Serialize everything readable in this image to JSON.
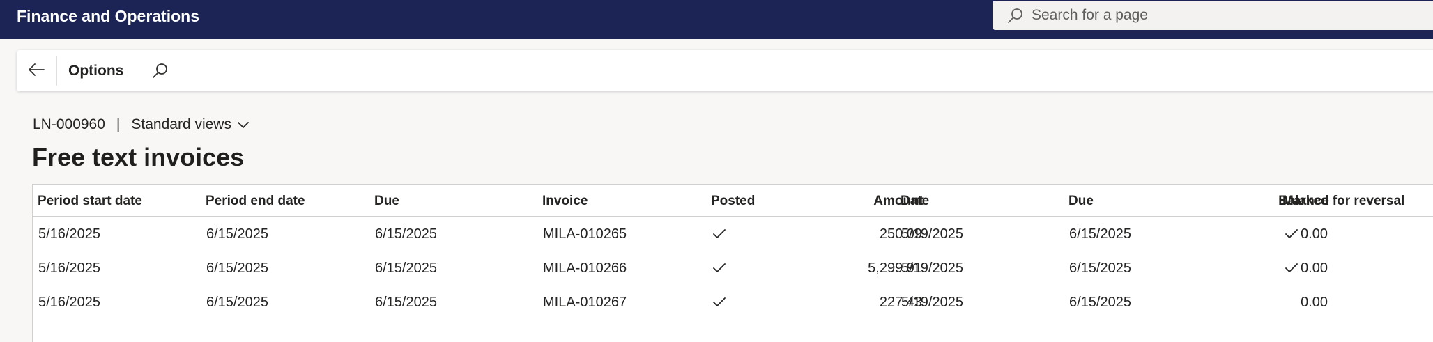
{
  "app": {
    "title": "Finance and Operations"
  },
  "search": {
    "placeholder": "Search for a page"
  },
  "actionpane": {
    "options_label": "Options"
  },
  "breadcrumb": {
    "record": "LN-000960",
    "separator": "|",
    "views_label": "Standard views"
  },
  "page": {
    "title": "Free text invoices"
  },
  "grid": {
    "columns": [
      "Period start date",
      "Period end date",
      "Due",
      "Invoice",
      "Posted",
      "Amount",
      "Date",
      "Due",
      "Balance",
      "Marked for reversal"
    ],
    "rows": [
      {
        "period_start": "5/16/2025",
        "period_end": "6/15/2025",
        "due": "6/15/2025",
        "invoice": "MILA-010265",
        "posted": true,
        "amount": "250.09",
        "date": "5/19/2025",
        "due2": "6/15/2025",
        "balance": "0.00",
        "marked_for_reversal": true
      },
      {
        "period_start": "5/16/2025",
        "period_end": "6/15/2025",
        "due": "6/15/2025",
        "invoice": "MILA-010266",
        "posted": true,
        "amount": "5,299.91",
        "date": "5/19/2025",
        "due2": "6/15/2025",
        "balance": "0.00",
        "marked_for_reversal": true
      },
      {
        "period_start": "5/16/2025",
        "period_end": "6/15/2025",
        "due": "6/15/2025",
        "invoice": "MILA-010267",
        "posted": true,
        "amount": "227.43",
        "date": "5/19/2025",
        "due2": "6/15/2025",
        "balance": "0.00",
        "marked_for_reversal": false
      }
    ]
  },
  "icons": {
    "search": "search-icon",
    "back": "back-arrow-icon",
    "chevron": "chevron-down-icon",
    "check": "checkmark-icon"
  },
  "colors": {
    "topbar": "#1b2454",
    "background": "#f8f7f6",
    "text": "#252423"
  }
}
